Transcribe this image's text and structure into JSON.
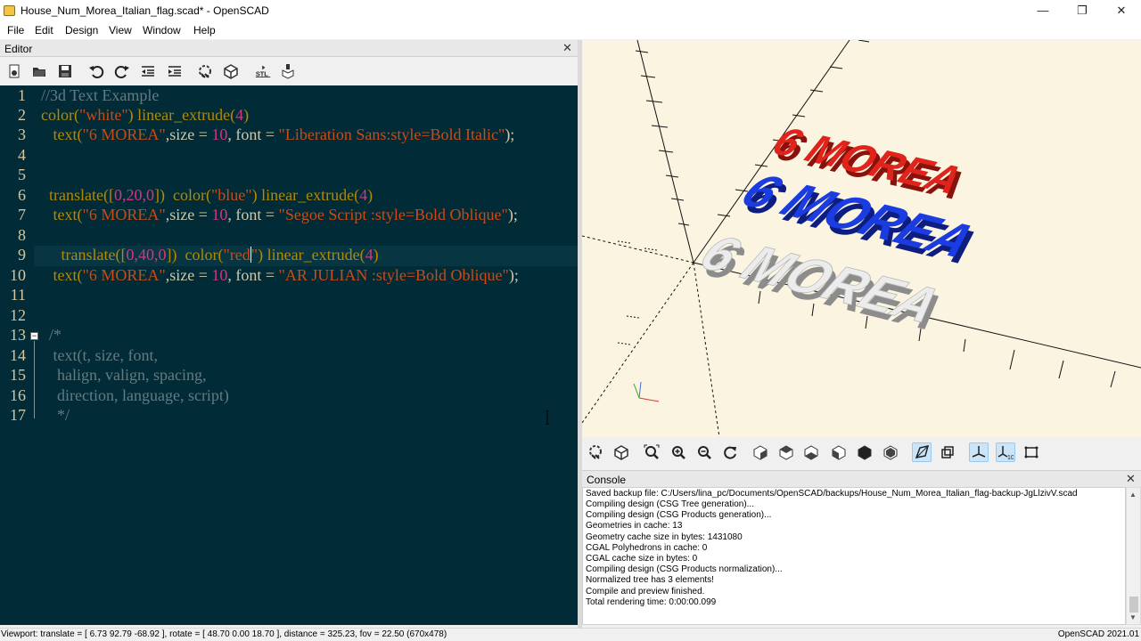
{
  "window": {
    "title": "House_Num_Morea_Italian_flag.scad* - OpenSCAD",
    "minimize": "—",
    "maximize": "❐",
    "close": "✕"
  },
  "menu": [
    "File",
    "Edit",
    "Design",
    "View",
    "Window",
    "Help"
  ],
  "editor": {
    "title": "Editor",
    "close": "✕",
    "toolbar_icons": [
      "new-file-icon",
      "open-file-icon",
      "save-icon",
      "undo-icon",
      "redo-icon",
      "unindent-icon",
      "indent-icon",
      "preview-icon",
      "render-icon",
      "export-stl-icon",
      "send-to-print-icon"
    ],
    "stl_label": "STL",
    "line_numbers": [
      "1",
      "2",
      "3",
      "4",
      "5",
      "6",
      "7",
      "8",
      "9",
      "10",
      "11",
      "12",
      "13",
      "14",
      "15",
      "16",
      "17"
    ],
    "code": {
      "l1": "//3d Text Example",
      "l2_fn": "color(",
      "l2_str": "\"white\"",
      "l2_mid": ") linear_extrude(",
      "l2_num": "4",
      "l2_end": ")",
      "l3_fn": "   text(",
      "l3_str1": "\"6 MOREA\"",
      "l3_mid": ",size = ",
      "l3_num": "10",
      "l3_mid2": ", font = ",
      "l3_str2": "\"Liberation Sans:style=Bold Italic\"",
      "l3_end": ");",
      "l6_fn": "  translate([",
      "l6_nums": "0,20,0",
      "l6_mid": "])  color(",
      "l6_str": "\"blue\"",
      "l6_mid2": ") linear_extrude(",
      "l6_num": "4",
      "l6_end": ")",
      "l7_fn": "   text(",
      "l7_str1": "\"6 MOREA\"",
      "l7_mid": ",size = ",
      "l7_num": "10",
      "l7_mid2": ", font = ",
      "l7_str2": "\"Segoe Script :style=Bold Oblique\"",
      "l7_end": ");",
      "l9_fn": "     translate([",
      "l9_nums": "0,40,0",
      "l9_mid": "])  color(",
      "l9_str_a": "\"red",
      "l9_str_b": "\"",
      "l9_mid2": ") linear_extrude(",
      "l9_num": "4",
      "l9_end": ")",
      "l10_fn": "   text(",
      "l10_str1": "\"6 MOREA\"",
      "l10_mid": ",size = ",
      "l10_num": "10",
      "l10_mid2": ", font = ",
      "l10_str2": "\"AR JULIAN :style=Bold Oblique\"",
      "l10_end": ");",
      "l13": "/*",
      "l14": "   text(t, size, font,",
      "l15": "    halign, valign, spacing,",
      "l16": "    direction, language, script)",
      "l17": "    */"
    }
  },
  "viewport": {
    "text_label": "6 MOREA",
    "colors": {
      "white": "#e6e6e6",
      "blue": "#1a3ce0",
      "red": "#e0231b",
      "background": "#fbf4e0"
    },
    "toolbar_icons": [
      "preview-icon",
      "render-icon",
      "zoom-all-icon",
      "zoom-in-icon",
      "zoom-out-icon",
      "reset-view-icon",
      "view-right-icon",
      "view-top-icon",
      "view-bottom-icon",
      "view-left-icon",
      "view-front-icon",
      "view-back-icon",
      "perspective-icon",
      "orthogonal-icon",
      "show-axes-icon",
      "show-scale-markers-icon",
      "show-edges-icon"
    ]
  },
  "console": {
    "title": "Console",
    "close": "✕",
    "lines": [
      "Saved backup file: C:/Users/lina_pc/Documents/OpenSCAD/backups/House_Num_Morea_Italian_flag-backup-JgLlzivV.scad",
      "Compiling design (CSG Tree generation)...",
      "Compiling design (CSG Products generation)...",
      "Geometries in cache: 13",
      "Geometry cache size in bytes: 1431080",
      "CGAL Polyhedrons in cache: 0",
      "CGAL cache size in bytes: 0",
      "Compiling design (CSG Products normalization)...",
      "Normalized tree has 3 elements!",
      "Compile and preview finished.",
      "Total rendering time: 0:00:00.099"
    ]
  },
  "status": {
    "viewport": "Viewport: translate = [ 6.73 92.79 -68.92 ], rotate = [ 48.70 0.00 18.70 ], distance = 325.23, fov = 22.50 (670x478)",
    "version": "OpenSCAD 2021.01"
  }
}
